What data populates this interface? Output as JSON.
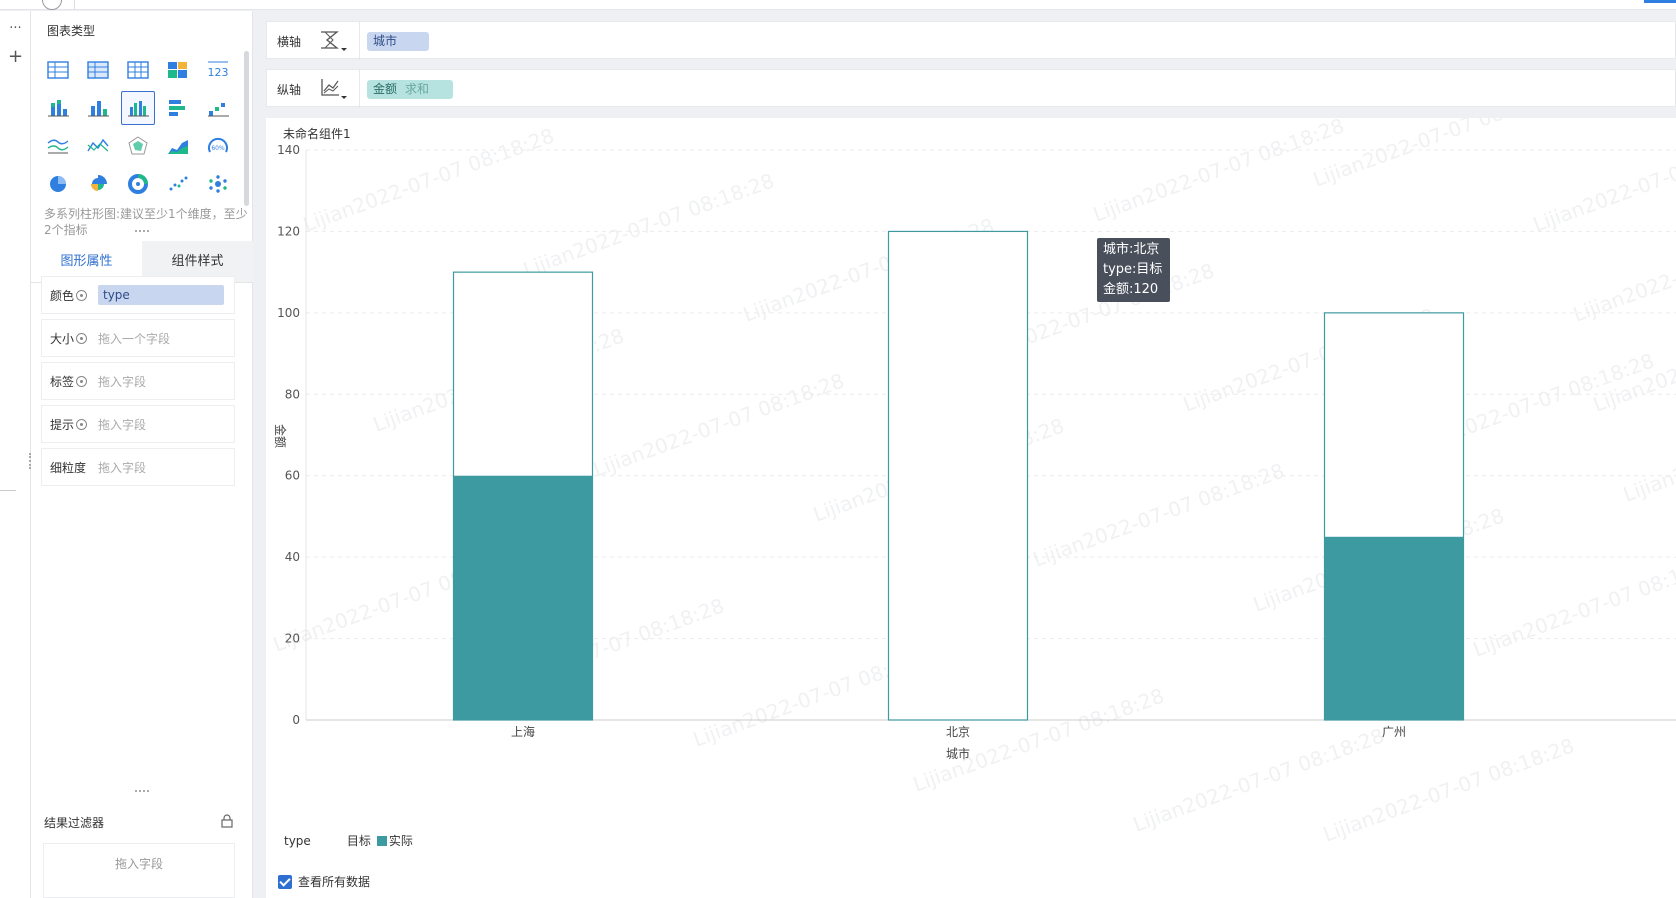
{
  "rail": {
    "more_icon": "ellipsis-icon",
    "add_icon": "plus-icon",
    "more_label": "···",
    "add_label": "+"
  },
  "panel": {
    "title": "图表类型",
    "chart_types": [
      "table-icon",
      "crosstab-icon",
      "detail-table-icon",
      "heat-table-icon",
      "kpi-number-icon",
      "stacked-bar-icon",
      "bar-icon",
      "multi-series-bar-icon",
      "horizontal-bar-icon",
      "waterfall-icon",
      "multi-line-icon",
      "line-icon",
      "radar-icon",
      "area-icon",
      "gauge-icon",
      "pie-icon",
      "rose-pie-icon",
      "ring-pie-icon",
      "scatter-icon",
      "bubble-icon"
    ],
    "kpi_label": "123",
    "gauge_label": "60%",
    "selected_index": 7,
    "hint": "多系列柱形图:建议至少1个维度，至少2个指标"
  },
  "tabs": {
    "graph_props": "图形属性",
    "component_style": "组件样式"
  },
  "props": {
    "color_label": "颜色",
    "color_value": "type",
    "size_label": "大小",
    "size_placeholder": "拖入一个字段",
    "tag_label": "标签",
    "tag_placeholder": "拖入字段",
    "tip_label": "提示",
    "tip_placeholder": "拖入字段",
    "granularity_label": "细粒度",
    "granularity_placeholder": "拖入字段"
  },
  "filter": {
    "title": "结果过滤器",
    "placeholder": "拖入字段"
  },
  "shelves": {
    "x_label": "横轴",
    "x_field": "城市",
    "y_label": "纵轴",
    "y_field": "金额",
    "y_agg": "求和"
  },
  "chart_title": "未命名组件1",
  "watermark": "Lijian2022-07-07 08:18:28",
  "tooltip": {
    "line1": "城市:北京",
    "line2": "type:目标",
    "line3": "金额:120"
  },
  "legend": {
    "title": "type",
    "items": [
      "目标",
      "实际"
    ]
  },
  "show_all_label": "查看所有数据",
  "colors": {
    "accent": "#2f6fd0",
    "actual": "#3d9aa1",
    "target_border": "#3d9aa1"
  },
  "chart_data": {
    "type": "bar",
    "title": "",
    "xlabel": "城市",
    "ylabel": "金额",
    "categories": [
      "上海",
      "北京",
      "广州"
    ],
    "series": [
      {
        "name": "目标",
        "values": [
          110,
          120,
          100
        ]
      },
      {
        "name": "实际",
        "values": [
          60,
          0,
          45
        ]
      }
    ],
    "ylim": [
      0,
      140
    ],
    "yticks": [
      0,
      20,
      40,
      60,
      80,
      100,
      120,
      140
    ],
    "grid": true,
    "legend_position": "bottom-left"
  }
}
